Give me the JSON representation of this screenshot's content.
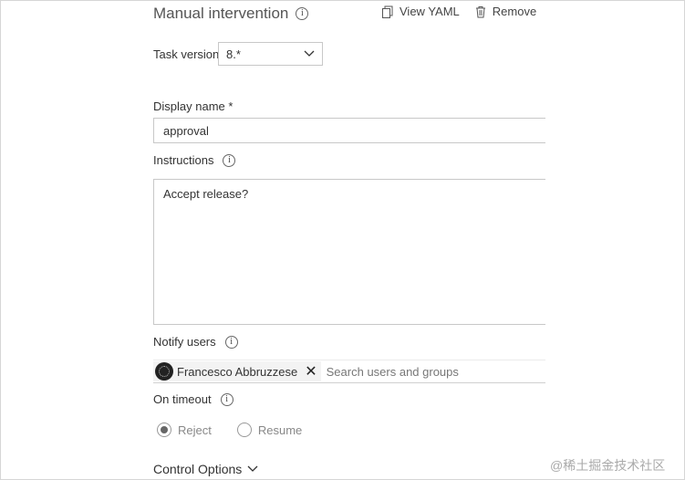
{
  "header": {
    "title": "Manual intervention",
    "view_yaml": "View YAML",
    "remove": "Remove"
  },
  "task_version": {
    "label": "Task version",
    "value": "8.*"
  },
  "display_name": {
    "label": "Display name *",
    "value": "approval"
  },
  "instructions": {
    "label": "Instructions",
    "value": "Accept release?"
  },
  "notify_users": {
    "label": "Notify users",
    "chip": "Francesco Abbruzzese",
    "placeholder": "Search users and groups"
  },
  "on_timeout": {
    "label": "On timeout",
    "options": [
      "Reject",
      "Resume"
    ],
    "selected": "Reject"
  },
  "control_options": {
    "label": "Control Options"
  },
  "watermark": "@稀土掘金技术社区",
  "icons": {
    "info": "info-icon",
    "copy": "copy-icon",
    "trash": "trash-icon",
    "chevron": "chevron-down-icon",
    "close": "close-icon"
  }
}
